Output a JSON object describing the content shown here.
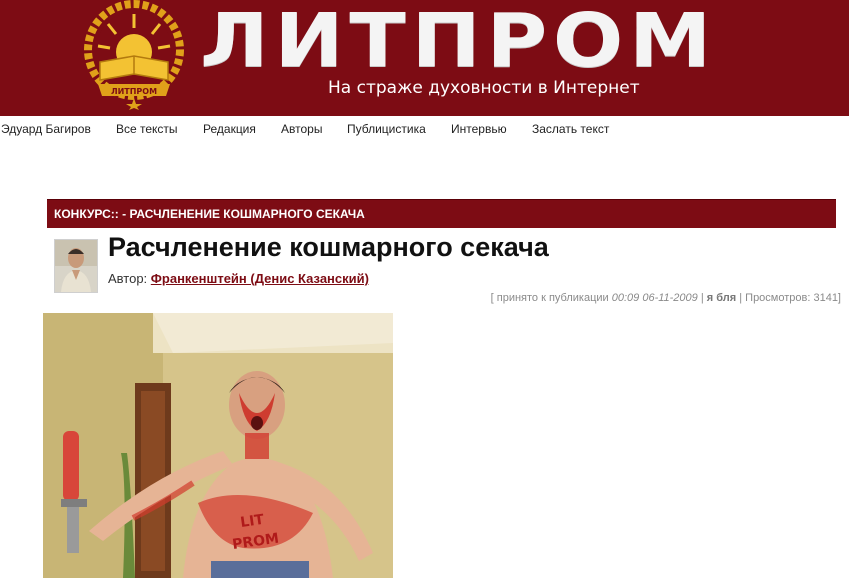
{
  "header": {
    "logo_text": "ЛИТПРОМ",
    "emblem_text": "ЛИТПРОМ",
    "tagline": "На страже духовности в Интернет",
    "bg_color": "#7d0c14"
  },
  "nav": {
    "items": [
      "Эдуард Багиров",
      "Все тексты",
      "Редакция",
      "Авторы",
      "Публицистика",
      "Интервью",
      "Заслать текст"
    ]
  },
  "section": {
    "title": "КОНКУРС:: - РАСЧЛЕНЕНИЕ КОШМАРНОГО СЕКАЧА"
  },
  "post": {
    "title": "Расчленение кошмарного секача",
    "author_label": "Автор:",
    "author_name": "Франкенштейн (Денис Казанский)",
    "meta": {
      "accepted_label": "[ принято к публикации",
      "time": "00:09",
      "date": "06-11-2009",
      "sep1": "|",
      "category": "я бля",
      "sep2": "|",
      "views_label": "Просмотров: 3141]"
    },
    "photo_text_1": "LIT",
    "photo_text_2": "PROM"
  }
}
